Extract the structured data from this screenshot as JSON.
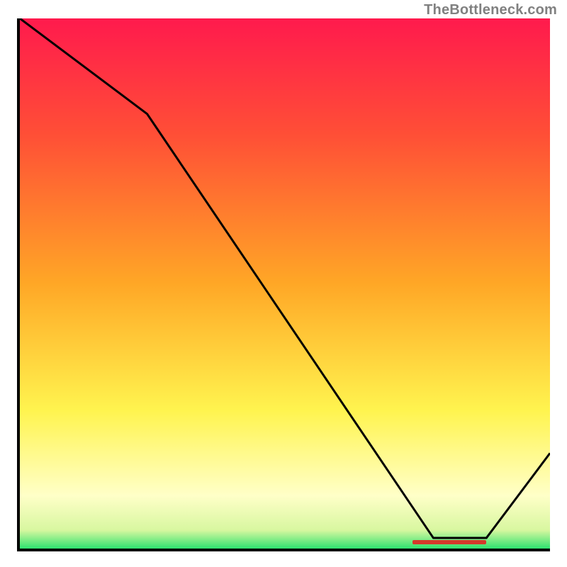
{
  "attribution": "TheBottleneck.com",
  "colors": {
    "grad_top": "#ff1a4d",
    "grad_mid_red": "#ff4f36",
    "grad_orange": "#ffa726",
    "grad_yellow": "#fff44f",
    "grad_pale": "#ffffc8",
    "grad_green": "#2ee36f",
    "line_black": "#000000",
    "marker_red": "#d43a2b"
  },
  "chart_data": {
    "type": "line",
    "title": "",
    "xlabel": "",
    "ylabel": "",
    "xlim": [
      0,
      100
    ],
    "ylim": [
      0,
      100
    ],
    "x": [
      0,
      24,
      78,
      88,
      100
    ],
    "values": [
      100,
      82,
      2,
      2,
      18
    ],
    "marker": {
      "x_start": 74,
      "x_end": 88,
      "y": 0.8,
      "color": "#d43a2b"
    },
    "gradient_stops": [
      {
        "offset": 0,
        "color": "#ff1a4d"
      },
      {
        "offset": 0.22,
        "color": "#ff4f36"
      },
      {
        "offset": 0.5,
        "color": "#ffa726"
      },
      {
        "offset": 0.74,
        "color": "#fff44f"
      },
      {
        "offset": 0.9,
        "color": "#ffffc8"
      },
      {
        "offset": 0.965,
        "color": "#d8f7a0"
      },
      {
        "offset": 1.0,
        "color": "#2ee36f"
      }
    ]
  }
}
